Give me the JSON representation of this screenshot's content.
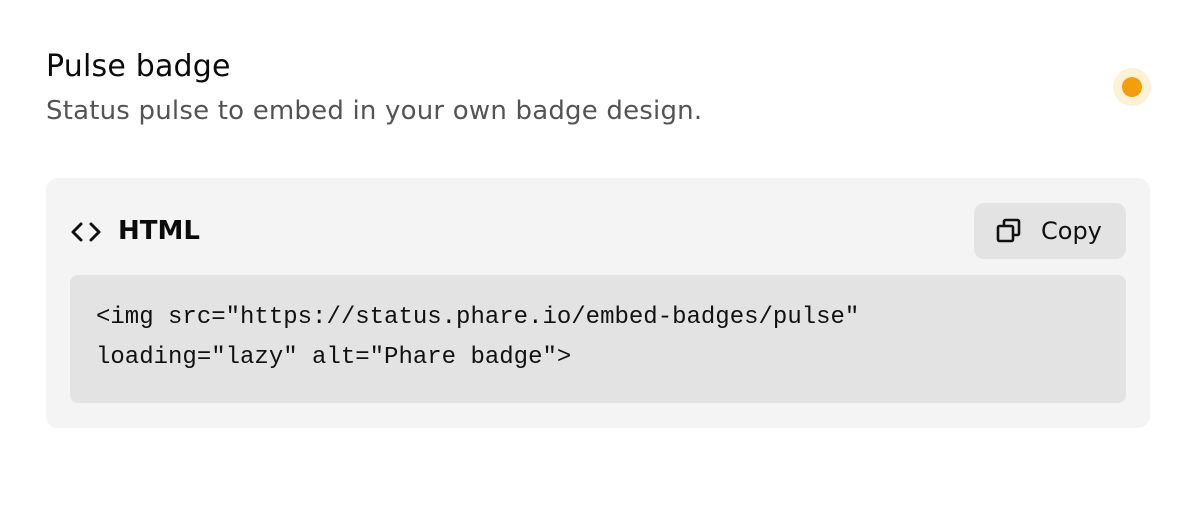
{
  "header": {
    "title": "Pulse badge",
    "subtitle": "Status pulse to embed in your own badge design."
  },
  "status": {
    "indicator_icon": "pulse-dot",
    "color": "#f59e0b"
  },
  "snippet": {
    "icon": "code-brackets-icon",
    "language_label": "HTML",
    "copy_icon": "copy-icon",
    "copy_label": "Copy",
    "code_lines": [
      "<img src=\"https://status.phare.io/embed-badges/pulse\"",
      "loading=\"lazy\" alt=\"Phare badge\">"
    ]
  }
}
